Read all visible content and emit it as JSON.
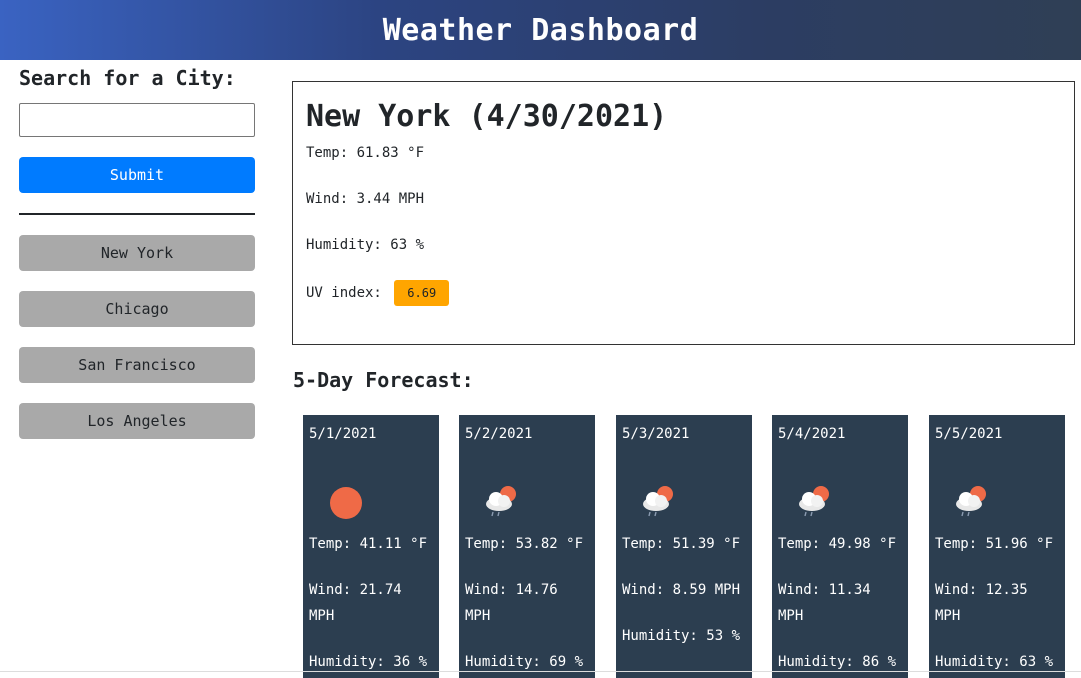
{
  "header": {
    "title": "Weather Dashboard"
  },
  "sidebar": {
    "search_label": "Search for a City:",
    "search_value": "",
    "submit_label": "Submit",
    "history": [
      "New York",
      "Chicago",
      "San Francisco",
      "Los Angeles"
    ]
  },
  "current": {
    "city_date": "New York (4/30/2021)",
    "temp": "Temp: 61.83 °F",
    "wind": "Wind: 3.44 MPH",
    "humidity": "Humidity: 63 %",
    "uv_label": "UV index:",
    "uv_value": "6.69",
    "uv_color": "#ffa500"
  },
  "forecast": {
    "title": "5-Day Forecast:",
    "days": [
      {
        "date": "5/1/2021",
        "icon": "sun-icon",
        "temp": "Temp: 41.11 °F",
        "wind": "Wind: 21.74 MPH",
        "humidity": "Humidity: 36 %"
      },
      {
        "date": "5/2/2021",
        "icon": "cloud-sun-rain-icon",
        "temp": "Temp: 53.82 °F",
        "wind": "Wind: 14.76 MPH",
        "humidity": "Humidity: 69 %"
      },
      {
        "date": "5/3/2021",
        "icon": "cloud-sun-rain-icon",
        "temp": "Temp: 51.39 °F",
        "wind": "Wind: 8.59 MPH",
        "humidity": "Humidity: 53 %"
      },
      {
        "date": "5/4/2021",
        "icon": "cloud-sun-rain-icon",
        "temp": "Temp: 49.98 °F",
        "wind": "Wind: 11.34 MPH",
        "humidity": "Humidity: 86 %"
      },
      {
        "date": "5/5/2021",
        "icon": "cloud-sun-rain-icon",
        "temp": "Temp: 51.96 °F",
        "wind": "Wind: 12.35 MPH",
        "humidity": "Humidity: 63 %"
      }
    ]
  },
  "colors": {
    "accent": "#007bff",
    "card_bg": "#2c3e50",
    "history_bg": "#a9a9a9",
    "sun": "#ef6a47"
  }
}
